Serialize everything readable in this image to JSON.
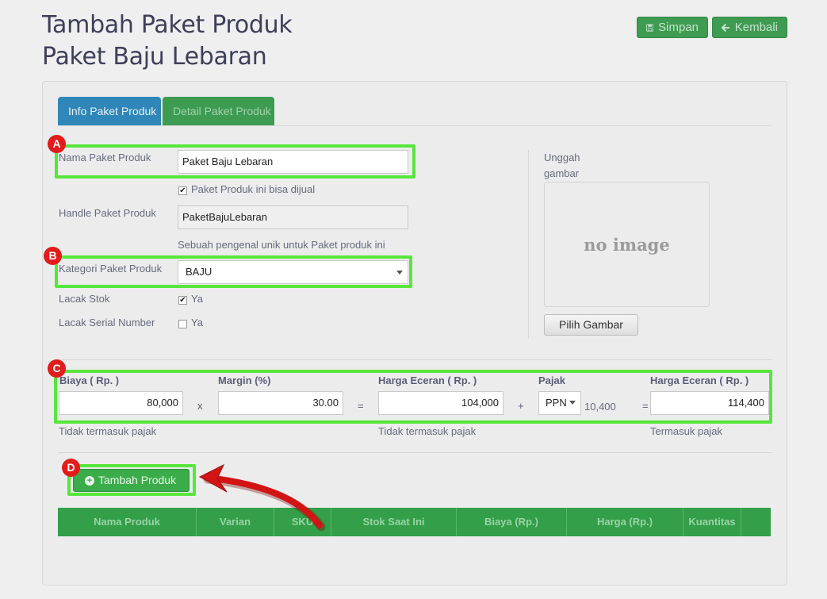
{
  "page": {
    "title_line1": "Tambah Paket Produk",
    "title_line2": "Paket Baju Lebaran"
  },
  "actions": {
    "save_label": "Simpan",
    "back_label": "Kembali"
  },
  "tabs": [
    {
      "label": "Info Paket Produk",
      "active": true
    },
    {
      "label": "Detail Paket Produk",
      "active": false
    }
  ],
  "form": {
    "name_label": "Nama Paket Produk",
    "name_value": "Paket Baju Lebaran",
    "sellable_label": "Paket Produk ini bisa dijual",
    "sellable_checked": true,
    "handle_label": "Handle Paket Produk",
    "handle_value": "PaketBajuLebaran",
    "handle_hint": "Sebuah pengenal unik untuk Paket produk ini",
    "category_label": "Kategori Paket Produk",
    "category_value": "BAJU",
    "track_stock_label": "Lacak Stok",
    "track_stock_option": "Ya",
    "track_stock_checked": true,
    "track_serial_label": "Lacak Serial Number",
    "track_serial_option": "Ya",
    "track_serial_checked": false
  },
  "image": {
    "upload_label_1": "Unggah",
    "upload_label_2": "gambar",
    "placeholder": "no image",
    "choose_button": "Pilih Gambar"
  },
  "pricing": {
    "cost_label": "Biaya ( Rp. )",
    "cost_value": "80,000",
    "cost_hint": "Tidak termasuk pajak",
    "op_times": "x",
    "margin_label": "Margin (%)",
    "margin_value": "30.00",
    "op_equals_1": "=",
    "retail_label": "Harga Eceran ( Rp. )",
    "retail_value": "104,000",
    "retail_hint": "Tidak termasuk pajak",
    "op_plus": "+",
    "tax_label": "Pajak",
    "tax_value": "PPN",
    "tax_amount": "10,400",
    "op_equals_2": "=",
    "retail_tax_label": "Harga Eceran ( Rp. )",
    "retail_tax_value": "114,400",
    "retail_tax_hint": "Termasuk pajak"
  },
  "products": {
    "add_button": "Tambah Produk",
    "columns": [
      "Nama Produk",
      "Varian",
      "SKU",
      "Stok Saat Ini",
      "Biaya (Rp.)",
      "Harga (Rp.)",
      "Kuantitas",
      ""
    ]
  },
  "annotations": {
    "a": "A",
    "b": "B",
    "c": "C",
    "d": "D"
  },
  "colors": {
    "highlight": "#57e63b",
    "badge": "#e21b1b",
    "primary_green": "#3e9b52",
    "tab_blue": "#2f87b9",
    "table_header": "#339f49",
    "arrow": "#d21414"
  }
}
